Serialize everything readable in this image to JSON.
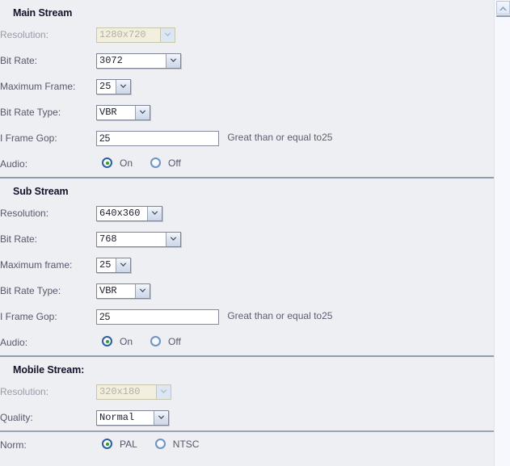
{
  "page": {
    "background_color": "#edeff3",
    "separator_color": "#8f9bb0"
  },
  "scrollbar": {
    "up_arrow_icon": "chevron-up-icon"
  },
  "sections": [
    {
      "title": "Main Stream",
      "rows": [
        {
          "label": "Resolution:",
          "control": "select",
          "value": "1280x720",
          "disabled": true
        },
        {
          "label": "Bit Rate:",
          "control": "select",
          "value": "3072",
          "disabled": false
        },
        {
          "label": "Maximum Frame:",
          "control": "select",
          "value": "25",
          "disabled": false
        },
        {
          "label": "Bit Rate Type:",
          "control": "select",
          "value": "VBR",
          "disabled": false
        },
        {
          "label": "I Frame Gop:",
          "control": "text",
          "value": "25",
          "hint": "Great than or equal to25"
        },
        {
          "label": "Audio:",
          "control": "radio",
          "options": [
            "On",
            "Off"
          ],
          "selected": "On"
        }
      ]
    },
    {
      "title": "Sub Stream",
      "rows": [
        {
          "label": "Resolution:",
          "control": "select",
          "value": "640x360",
          "disabled": false
        },
        {
          "label": "Bit Rate:",
          "control": "select",
          "value": "768",
          "disabled": false
        },
        {
          "label": "Maximum frame:",
          "control": "select",
          "value": "25",
          "disabled": false
        },
        {
          "label": "Bit Rate Type:",
          "control": "select",
          "value": "VBR",
          "disabled": false
        },
        {
          "label": "I Frame Gop:",
          "control": "text",
          "value": "25",
          "hint": "Great than or equal to25"
        },
        {
          "label": "Audio:",
          "control": "radio",
          "options": [
            "On",
            "Off"
          ],
          "selected": "On"
        }
      ]
    },
    {
      "title": "Mobile Stream:",
      "rows": [
        {
          "label": "Resolution:",
          "control": "select",
          "value": "320x180",
          "disabled": true
        },
        {
          "label": "Quality:",
          "control": "select",
          "value": "Normal",
          "disabled": false
        }
      ]
    },
    {
      "title": "",
      "rows": [
        {
          "label": "Norm:",
          "control": "radio",
          "options": [
            "PAL",
            "NTSC"
          ],
          "selected": "PAL"
        }
      ]
    }
  ],
  "main_stream": {
    "title": "Main Stream",
    "resolution": {
      "label": "Resolution:",
      "value": "1280x720"
    },
    "bit_rate": {
      "label": "Bit Rate:",
      "value": "3072"
    },
    "maximum_frame": {
      "label": "Maximum Frame:",
      "value": "25"
    },
    "bit_rate_type": {
      "label": "Bit Rate Type:",
      "value": "VBR"
    },
    "i_frame_gop": {
      "label": "I Frame Gop:",
      "value": "25",
      "hint": "Great than or equal to25"
    },
    "audio": {
      "label": "Audio:",
      "on": "On",
      "off": "Off",
      "selected": "On"
    }
  },
  "sub_stream": {
    "title": "Sub Stream",
    "resolution": {
      "label": "Resolution:",
      "value": "640x360"
    },
    "bit_rate": {
      "label": "Bit Rate:",
      "value": "768"
    },
    "maximum_frame": {
      "label": "Maximum frame:",
      "value": "25"
    },
    "bit_rate_type": {
      "label": "Bit Rate Type:",
      "value": "VBR"
    },
    "i_frame_gop": {
      "label": "I Frame Gop:",
      "value": "25",
      "hint": "Great than or equal to25"
    },
    "audio": {
      "label": "Audio:",
      "on": "On",
      "off": "Off",
      "selected": "On"
    }
  },
  "mobile_stream": {
    "title": "Mobile Stream:",
    "resolution": {
      "label": "Resolution:",
      "value": "320x180"
    },
    "quality": {
      "label": "Quality:",
      "value": "Normal"
    }
  },
  "norm": {
    "label": "Norm:",
    "pal": "PAL",
    "ntsc": "NTSC",
    "selected": "PAL"
  }
}
